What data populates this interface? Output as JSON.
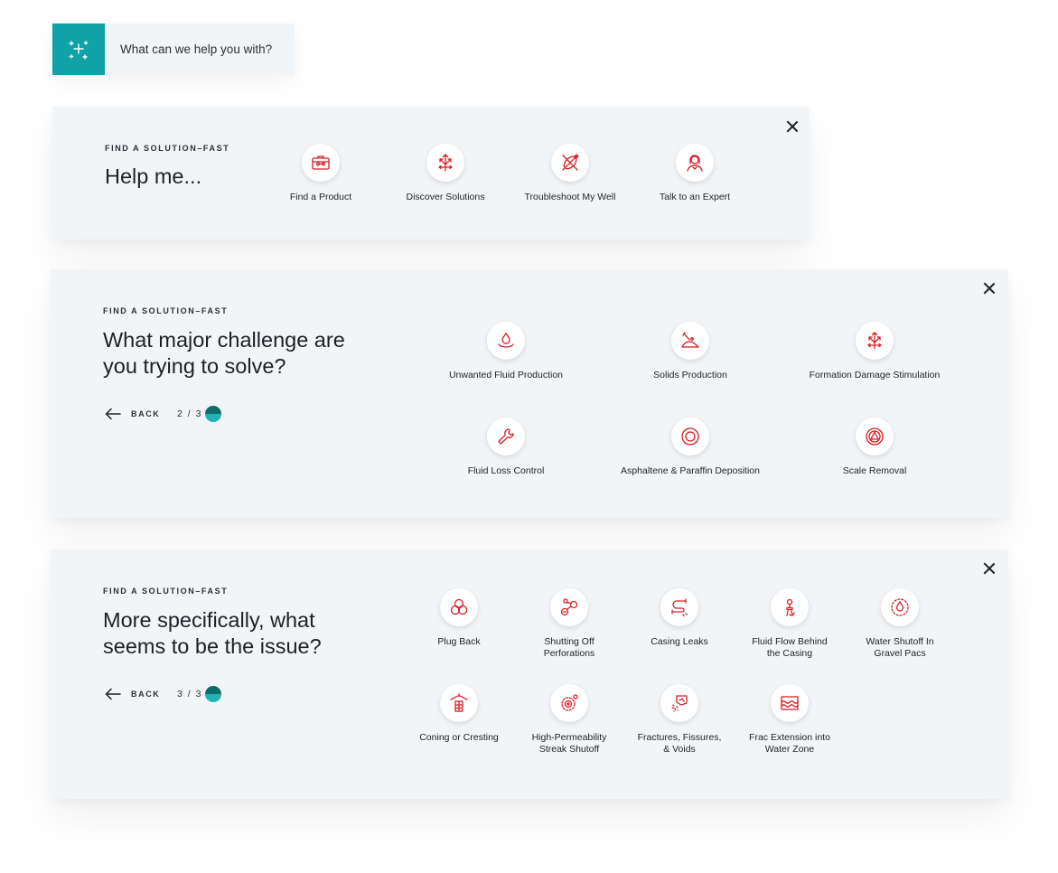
{
  "search": {
    "prompt": "What can we help you with?",
    "icon": "sparkle-icon",
    "accent": "#0fa3a7"
  },
  "colors": {
    "icon_red": "#d81c22",
    "panel_bg": "#f2f5f8"
  },
  "panel1": {
    "eyebrow": "FIND A SOLUTION–FAST",
    "title": "Help me...",
    "options": [
      {
        "label": "Find a Product",
        "icon": "toolbox-icon"
      },
      {
        "label": "Discover Solutions",
        "icon": "arrows-diverging-icon"
      },
      {
        "label": "Troubleshoot My Well",
        "icon": "troubleshoot-icon"
      },
      {
        "label": "Talk to an Expert",
        "icon": "expert-icon"
      }
    ]
  },
  "panel2": {
    "eyebrow": "FIND A SOLUTION–FAST",
    "title_line1": "What major challenge are",
    "title_line2": "you trying to solve?",
    "back": "BACK",
    "step": "2 / 3",
    "options": [
      {
        "label": "Unwanted Fluid Production",
        "icon": "fluid-drop-icon"
      },
      {
        "label": "Solids Production",
        "icon": "solids-pile-icon"
      },
      {
        "label": "Formation Damage Stimulation",
        "icon": "arrows-diverging-icon"
      },
      {
        "label": "Fluid Loss Control",
        "icon": "wrench-icon"
      },
      {
        "label": "Asphaltene & Paraffin Deposition",
        "icon": "concentric-rings-icon"
      },
      {
        "label": "Scale Removal",
        "icon": "pipe-scale-icon"
      }
    ]
  },
  "panel3": {
    "eyebrow": "FIND A SOLUTION–FAST",
    "title_line1": "More specifically, what",
    "title_line2": "seems to be the issue?",
    "back": "BACK",
    "step": "3 / 3",
    "options": [
      {
        "line1": "Plug Back",
        "line2": "",
        "icon": "triple-circles-icon"
      },
      {
        "line1": "Shutting Off",
        "line2": "Perforations",
        "icon": "perforations-icon"
      },
      {
        "line1": "Casing Leaks",
        "line2": "",
        "icon": "casing-leak-icon"
      },
      {
        "line1": "Fluid Flow Behind",
        "line2": "the Casing",
        "icon": "flow-behind-casing-icon"
      },
      {
        "line1": "Water Shutoff In",
        "line2": "Gravel Pacs",
        "icon": "water-drop-ring-icon"
      },
      {
        "line1": "Coning or Cresting",
        "line2": "",
        "icon": "coning-icon"
      },
      {
        "line1": "High-Permeability",
        "line2": "Streak Shutoff",
        "icon": "permeability-icon"
      },
      {
        "line1": "Fractures, Fissures,",
        "line2": "& Voids",
        "icon": "fractures-icon"
      },
      {
        "line1": "Frac Extension into",
        "line2": "Water Zone",
        "icon": "water-zone-icon"
      }
    ]
  }
}
